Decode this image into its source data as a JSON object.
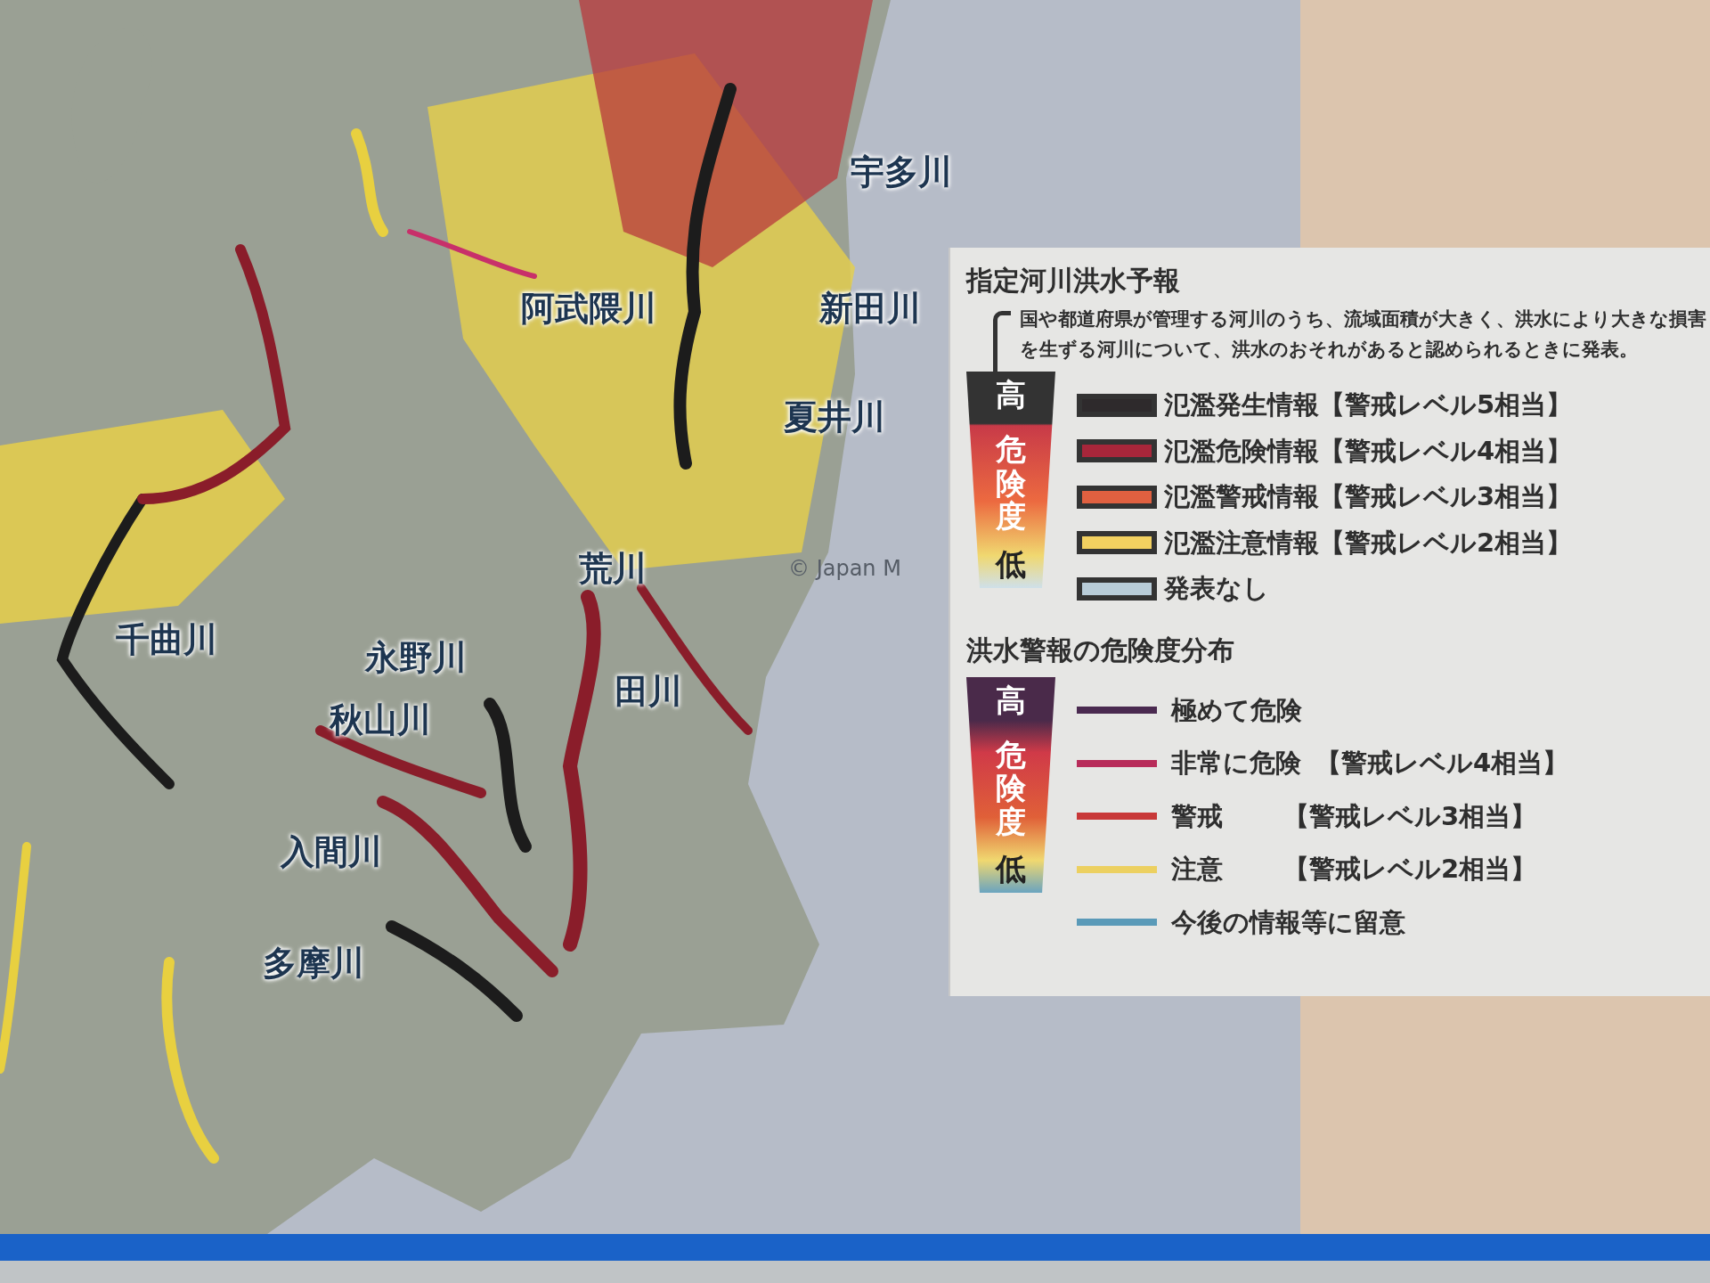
{
  "map": {
    "river_labels": [
      {
        "name": "宇多川"
      },
      {
        "name": "阿武隈川"
      },
      {
        "name": "新田川"
      },
      {
        "name": "夏井川"
      },
      {
        "name": "荒川"
      },
      {
        "name": "千曲川"
      },
      {
        "name": "永野川"
      },
      {
        "name": "田川"
      },
      {
        "name": "秋山川"
      },
      {
        "name": "入間川"
      },
      {
        "name": "多摩川"
      }
    ],
    "credit": "© Japan M"
  },
  "legend": {
    "forecast": {
      "title": "指定河川洪水予報",
      "note": "国や都道府県が管理する河川のうち、流域面積が大きく、洪水により大きな損害を生ずる河川について、洪水のおそれがあると認められるときに発表。",
      "scale": {
        "high": "高",
        "middle": "危険度",
        "low": "低"
      },
      "items": [
        {
          "label": "氾濫発生情報【警戒レベル5相当】",
          "color": "#2e2a2c"
        },
        {
          "label": "氾濫危険情報【警戒レベル4相当】",
          "color": "#a8263a"
        },
        {
          "label": "氾濫警戒情報【警戒レベル3相当】",
          "color": "#e06040"
        },
        {
          "label": "氾濫注意情報【警戒レベル2相当】",
          "color": "#f2d060"
        },
        {
          "label": "発表なし",
          "color": "#b8ccd8"
        }
      ]
    },
    "warning": {
      "title": "洪水警報の危険度分布",
      "scale": {
        "high": "高",
        "middle": "危険度",
        "low": "低"
      },
      "items": [
        {
          "label": "極めて危険",
          "color": "#4a2a50"
        },
        {
          "label": "非常に危険",
          "level": "【警戒レベル4相当】",
          "color": "#b82c5a"
        },
        {
          "label": "警戒",
          "level": "【警戒レベル3相当】",
          "color": "#c83838"
        },
        {
          "label": "注意",
          "level": "【警戒レベル2相当】",
          "color": "#ecd060"
        },
        {
          "label": "今後の情報等に留意",
          "color": "#5a9ab8"
        }
      ]
    }
  }
}
